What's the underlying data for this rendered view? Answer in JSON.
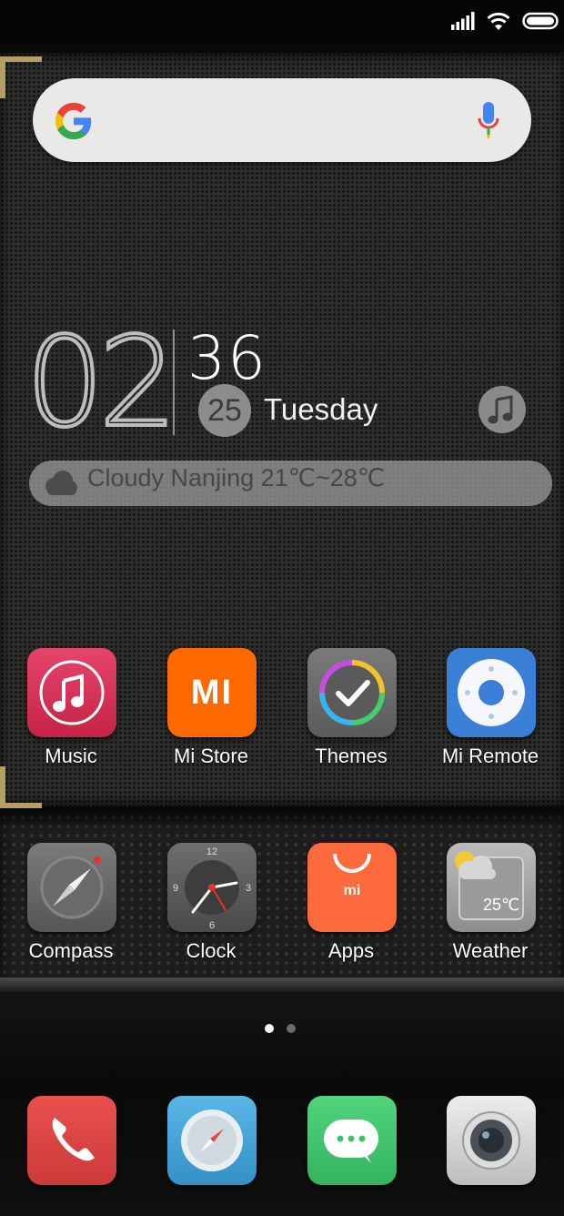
{
  "clock": {
    "hour": "02",
    "minutes": "36",
    "date": "25",
    "weekday": "Tuesday"
  },
  "weather_widget": {
    "text": "Cloudy Nanjing 21℃~28℃"
  },
  "home_row1": [
    {
      "label": "Music",
      "icon": "music-icon"
    },
    {
      "label": "Mi Store",
      "icon": "mi-store-icon"
    },
    {
      "label": "Themes",
      "icon": "themes-icon"
    },
    {
      "label": "Mi Remote",
      "icon": "mi-remote-icon"
    }
  ],
  "home_row2": [
    {
      "label": "Compass",
      "icon": "compass-icon"
    },
    {
      "label": "Clock",
      "icon": "clock-icon"
    },
    {
      "label": "Apps",
      "icon": "apps-icon"
    },
    {
      "label": "Weather",
      "icon": "weather-icon"
    }
  ],
  "icon_texts": {
    "mi_logo": "MI",
    "apps_logo": "mi",
    "weather_temp": "25℃",
    "clock_12": "12",
    "clock_3": "3",
    "clock_6": "6",
    "clock_9": "9"
  },
  "pager": {
    "current_page": 1,
    "total_pages": 2
  },
  "dock": [
    {
      "icon": "phone-icon"
    },
    {
      "icon": "browser-icon"
    },
    {
      "icon": "messaging-icon"
    },
    {
      "icon": "camera-icon"
    }
  ],
  "colors": {
    "accent_gold": "#b59d63",
    "music": "#d8335a",
    "mi_store": "#ff6a00",
    "mi_remote": "#3a7fd8",
    "apps": "#ff6a3d",
    "phone": "#d9403f",
    "browser": "#3d9fd1",
    "messaging": "#3ec46a"
  }
}
